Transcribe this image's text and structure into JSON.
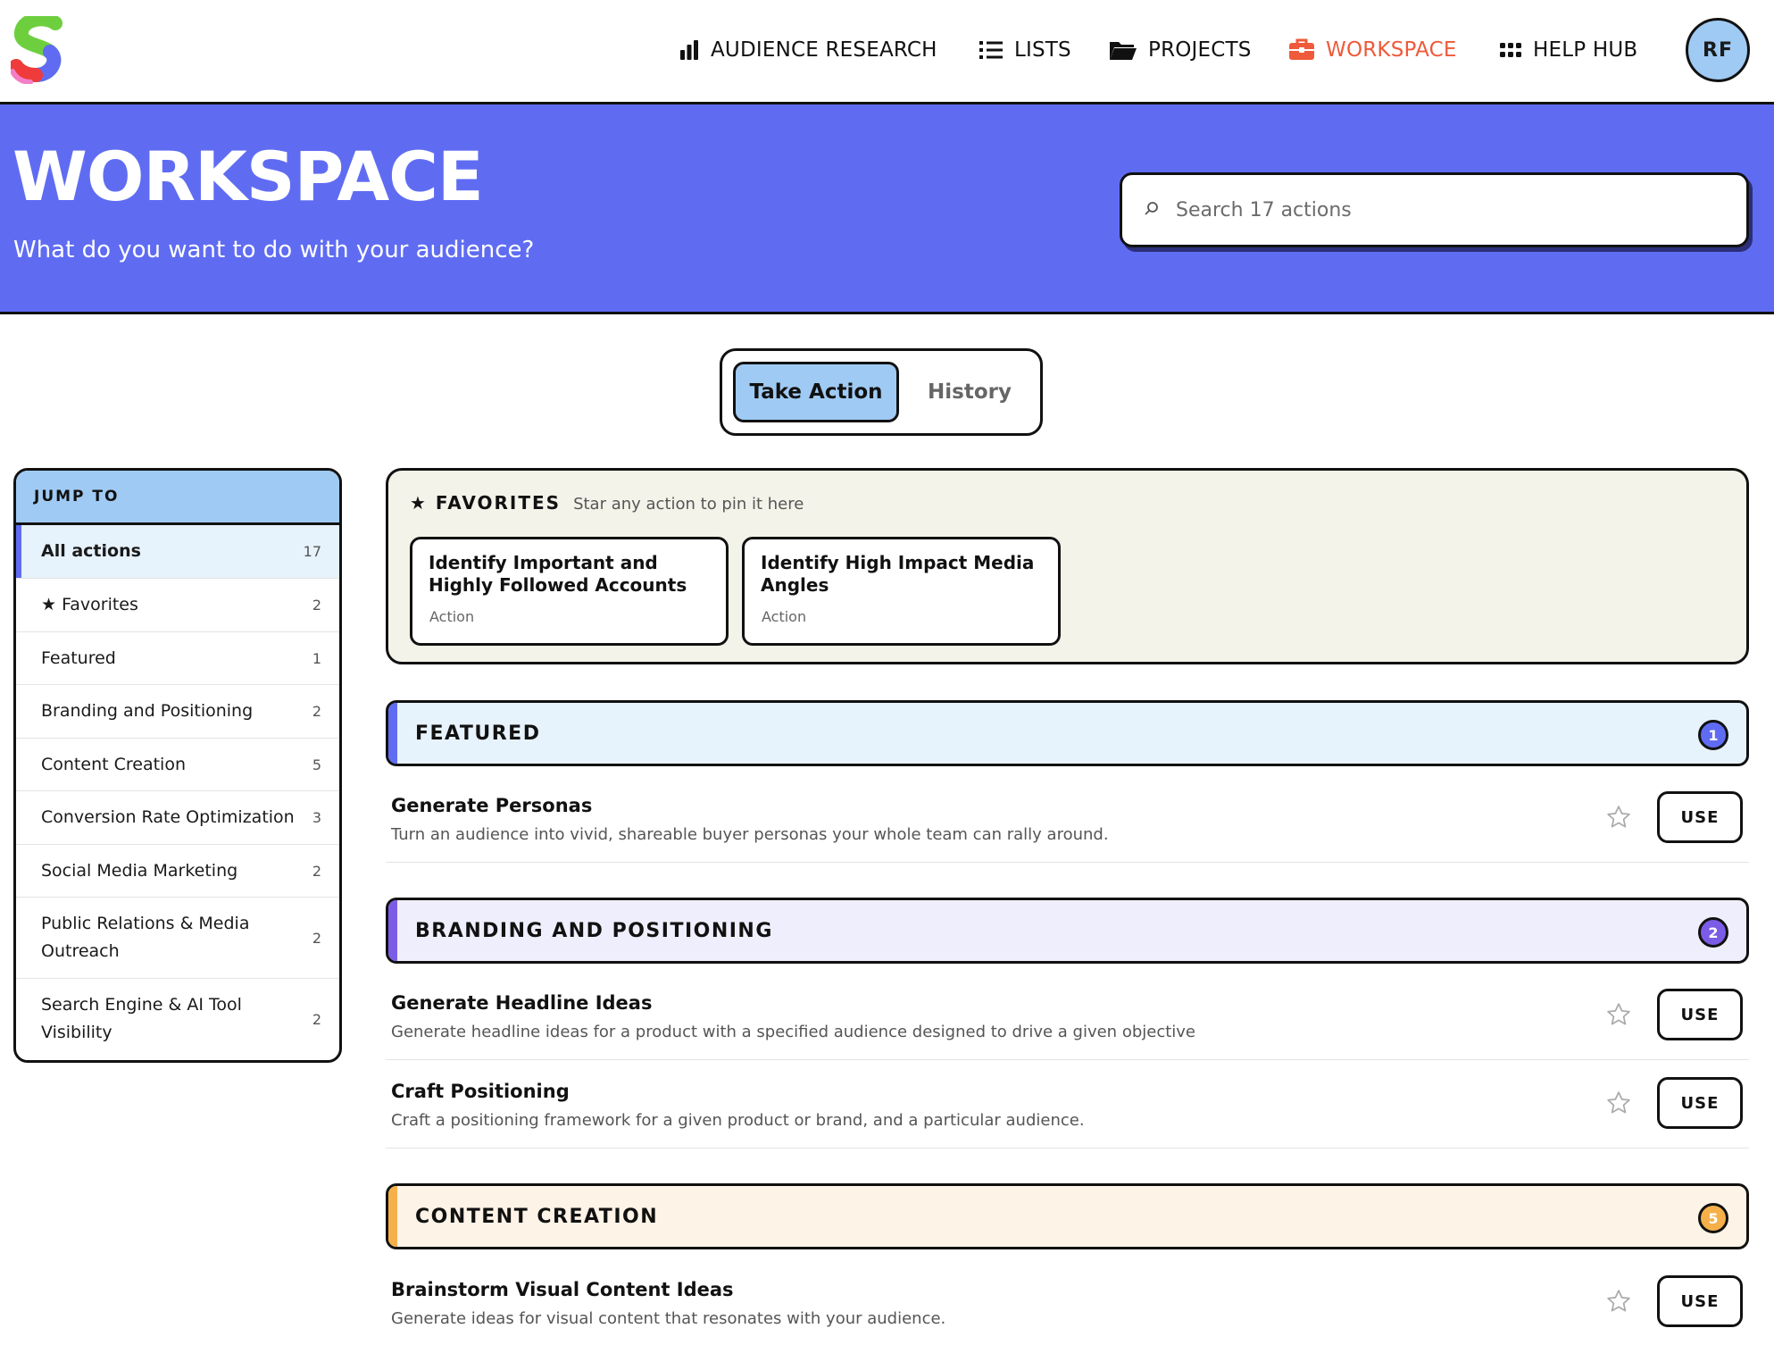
{
  "nav": {
    "items": [
      {
        "label": "AUDIENCE RESEARCH",
        "icon": "bar-chart-icon"
      },
      {
        "label": "LISTS",
        "icon": "list-icon"
      },
      {
        "label": "PROJECTS",
        "icon": "folder-icon"
      },
      {
        "label": "WORKSPACE",
        "icon": "briefcase-icon",
        "active": true
      },
      {
        "label": "HELP HUB",
        "icon": "grid-dots-icon"
      }
    ],
    "avatar_initials": "RF",
    "active_color": "#ee5a3a"
  },
  "hero": {
    "title": "WORKSPACE",
    "subtitle": "What do you want to do with your audience?",
    "search_placeholder": "Search 17 actions",
    "background": "#5f6cf2"
  },
  "tabs": {
    "active": "Take Action",
    "inactive": "History"
  },
  "sidebar": {
    "heading": "JUMP TO",
    "items": [
      {
        "label": "All actions",
        "count": "17"
      },
      {
        "label": "★ Favorites",
        "count": "2"
      },
      {
        "label": "Featured",
        "count": "1"
      },
      {
        "label": "Branding and Positioning",
        "count": "2"
      },
      {
        "label": "Content Creation",
        "count": "5"
      },
      {
        "label": "Conversion Rate Optimization",
        "count": "3"
      },
      {
        "label": "Social Media Marketing",
        "count": "2"
      },
      {
        "label": "Public Relations & Media Outreach",
        "count": "2"
      },
      {
        "label": "Search Engine & AI Tool Visibility",
        "count": "2"
      }
    ]
  },
  "favorites": {
    "title": "★ FAVORITES",
    "hint": "Star any action to pin it here",
    "cards": [
      {
        "title": "Identify Important and Highly Followed Accounts",
        "type": "Action"
      },
      {
        "title": "Identify High Impact Media Angles",
        "type": "Action"
      }
    ]
  },
  "sections": [
    {
      "title": "FEATURED",
      "count": "1",
      "accent": "#5f6cf2",
      "bg": "#e6f2fc",
      "actions": [
        {
          "name": "Generate Personas",
          "desc": "Turn an audience into vivid, shareable buyer personas your whole team can rally around.",
          "button": "USE"
        }
      ]
    },
    {
      "title": "BRANDING AND POSITIONING",
      "count": "2",
      "accent": "#7b5ce6",
      "bg": "#efeefc",
      "actions": [
        {
          "name": "Generate Headline Ideas",
          "desc": "Generate headline ideas for a product with a specified audience designed to drive a given objective",
          "button": "USE"
        },
        {
          "name": "Craft Positioning",
          "desc": "Craft a positioning framework for a given product or brand, and a particular audience.",
          "button": "USE"
        }
      ]
    },
    {
      "title": "CONTENT CREATION",
      "count": "5",
      "accent": "#f5b04a",
      "bg": "#fdf3e6",
      "actions": [
        {
          "name": "Brainstorm Visual Content Ideas",
          "desc": "Generate ideas for visual content that resonates with your audience.",
          "button": "USE"
        }
      ]
    }
  ]
}
